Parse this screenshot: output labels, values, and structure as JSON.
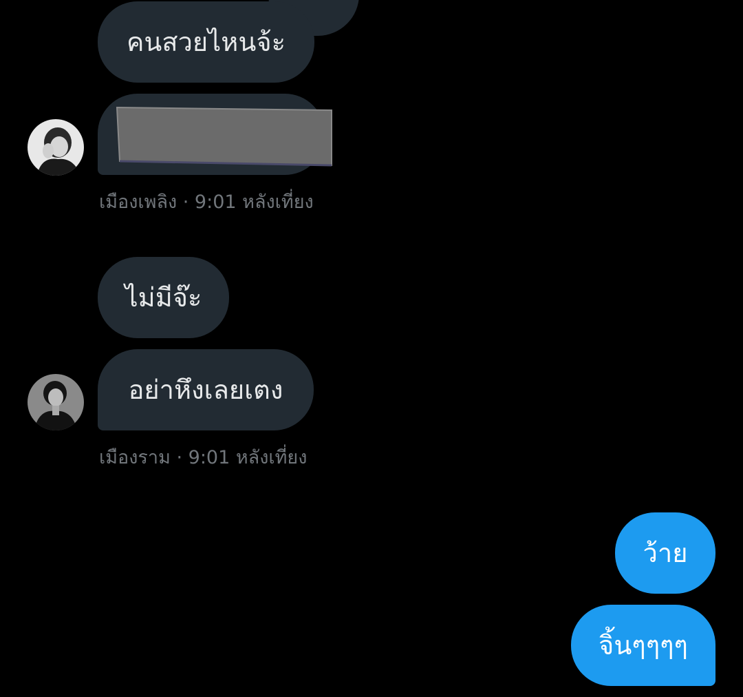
{
  "conversation": {
    "messages": [
      {
        "id": "m1",
        "direction": "incoming",
        "text": "คนสวยไหนจ้ะ"
      },
      {
        "id": "m2",
        "direction": "incoming",
        "type": "redacted-image",
        "redaction_color": "#6b6b6b"
      },
      {
        "id": "m3",
        "direction": "incoming",
        "text": "ไม่มีจ๊ะ"
      },
      {
        "id": "m4",
        "direction": "incoming",
        "text": "อย่าหึงเลยเตง"
      },
      {
        "id": "m5",
        "direction": "outgoing",
        "text": "ว้าย"
      },
      {
        "id": "m6",
        "direction": "outgoing",
        "text": "จิ้นๆๆๆๆ"
      }
    ],
    "meta": [
      {
        "sender": "เมืองเพลิง",
        "time": "9:01 หลังเที่ยง",
        "line": "เมืองเพลิง · 9:01 หลังเที่ยง"
      },
      {
        "sender": "เมืองราม",
        "time": "9:01 หลังเที่ยง",
        "line": "เมืองราม · 9:01 หลังเที่ยง"
      }
    ]
  },
  "colors": {
    "background": "#000000",
    "incoming_bubble": "#222b33",
    "outgoing_bubble": "#1d9bf0",
    "meta_text": "#71767b",
    "bubble_text": "#e7e9ea"
  }
}
